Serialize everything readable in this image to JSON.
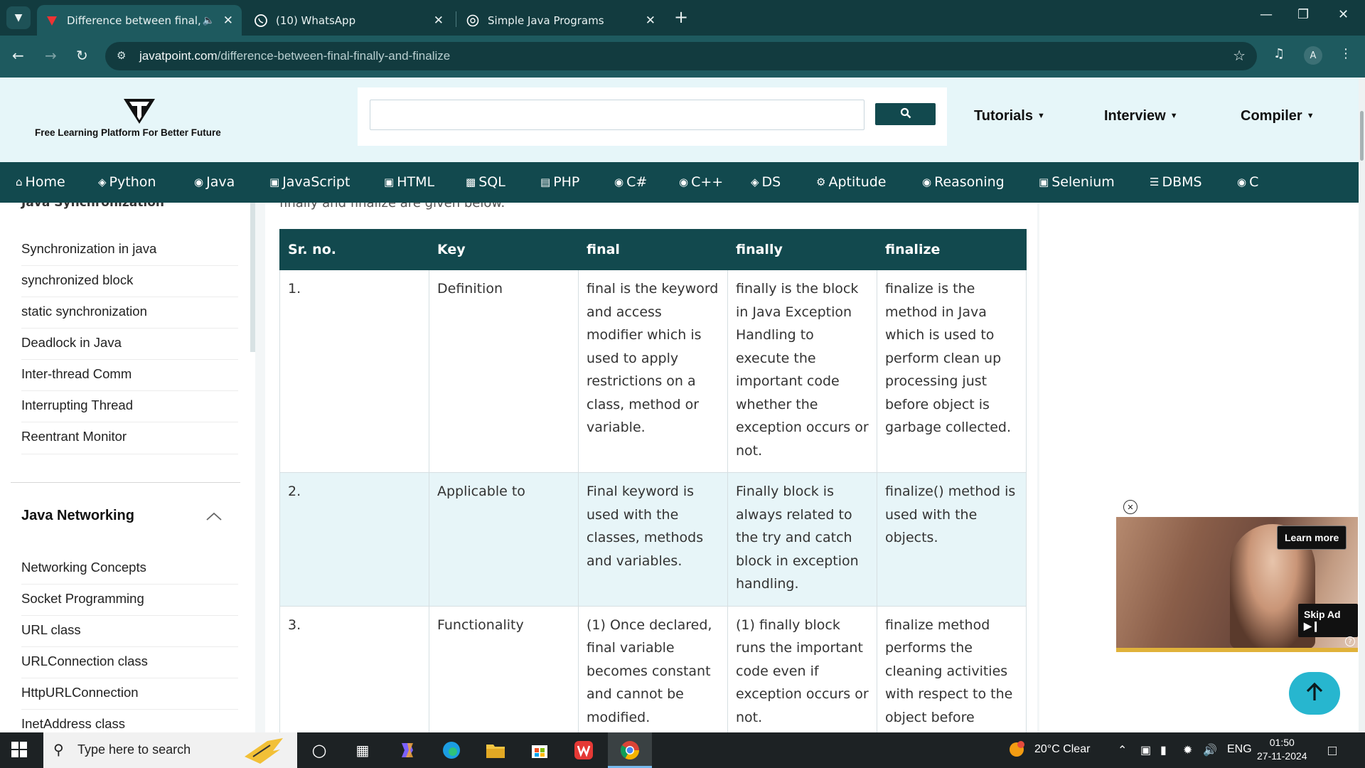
{
  "browser": {
    "tabs": [
      {
        "title": "Difference between final, fin",
        "active": true
      },
      {
        "title": "(10) WhatsApp",
        "active": false
      },
      {
        "title": "Simple Java Programs",
        "active": false
      }
    ],
    "url_domain": "javatpoint.com",
    "url_path": "/difference-between-final-finally-and-finalize",
    "profile_initial": "A"
  },
  "site": {
    "tagline": "Free Learning Platform For Better Future",
    "header_menus": [
      "Tutorials",
      "Interview",
      "Compiler"
    ],
    "nav": [
      "Home",
      "Python",
      "Java",
      "JavaScript",
      "HTML",
      "SQL",
      "PHP",
      "C#",
      "C++",
      "DS",
      "Aptitude",
      "Reasoning",
      "Selenium",
      "DBMS",
      "C"
    ]
  },
  "sidebar": {
    "cut_heading": "Java Synchronization",
    "items": [
      "Synchronization in java",
      "synchronized block",
      "static synchronization",
      "Deadlock in Java",
      "Inter-thread Comm",
      "Interrupting Thread",
      "Reentrant Monitor"
    ],
    "section_heading": "Java Networking",
    "section_items": [
      "Networking Concepts",
      "Socket Programming",
      "URL class",
      "URLConnection class",
      "HttpURLConnection",
      "InetAddress class"
    ]
  },
  "content": {
    "intro_cut": "finally and finalize are given below.",
    "table": {
      "headers": [
        "Sr. no.",
        "Key",
        "final",
        "finally",
        "finalize"
      ],
      "rows": [
        [
          "1.",
          "Definition",
          "final is the keyword and access modifier which is used to apply restrictions on a class, method or variable.",
          "finally is the block in Java Exception Handling to execute the important code whether the exception occurs or not.",
          "finalize is the method in Java which is used to perform clean up processing just before object is garbage collected."
        ],
        [
          "2.",
          "Applicable to",
          "Final keyword is used with the classes, methods and variables.",
          "Finally block is always related to the try and catch block in exception handling.",
          "finalize() method is used with the objects."
        ],
        [
          "3.",
          "Functionality",
          "(1) Once declared, final variable becomes constant and cannot be modified.",
          "(1) finally block runs the important code even if exception occurs or not.",
          "finalize method performs the cleaning activities with respect to the object before"
        ]
      ]
    }
  },
  "ad": {
    "learn_more": "Learn more",
    "skip": "Skip Ad"
  },
  "taskbar": {
    "search_placeholder": "Type here to search",
    "weather": "20°C  Clear",
    "lang": "ENG",
    "time": "01:50",
    "date": "27-11-2024"
  }
}
